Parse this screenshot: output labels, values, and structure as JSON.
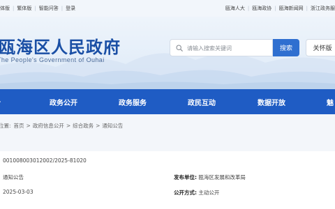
{
  "topbar": {
    "left_links": [
      "体版",
      "繁体版",
      "智能问答",
      "登录"
    ],
    "right_links": [
      "瓯海人大",
      "瓯海政协",
      "瓯海新闻网",
      "浙江政务服"
    ]
  },
  "header": {
    "title": "瓯海区人民政府",
    "subtitle": "The People's Government of Ouhai",
    "search_placeholder": "请输入搜索关键词",
    "search_button": "搜索",
    "care_button": "关怀版"
  },
  "nav": {
    "items": [
      "",
      "政务公开",
      "政务服务",
      "政民互动",
      "数据开放",
      "魅"
    ]
  },
  "breadcrumb": {
    "items": [
      "位置:",
      "首页",
      "政府信息公开",
      "综合政务",
      "通知公告"
    ],
    "separator": ">"
  },
  "article_meta": {
    "index_no": "001008003012002/2025-81020",
    "category": "通知公告",
    "date": "2025-03-03",
    "publisher_label": "发布单位:",
    "publisher": "瓯海区发展和改革局",
    "open_method_label": "公开方式:",
    "open_method": "主动公开"
  }
}
